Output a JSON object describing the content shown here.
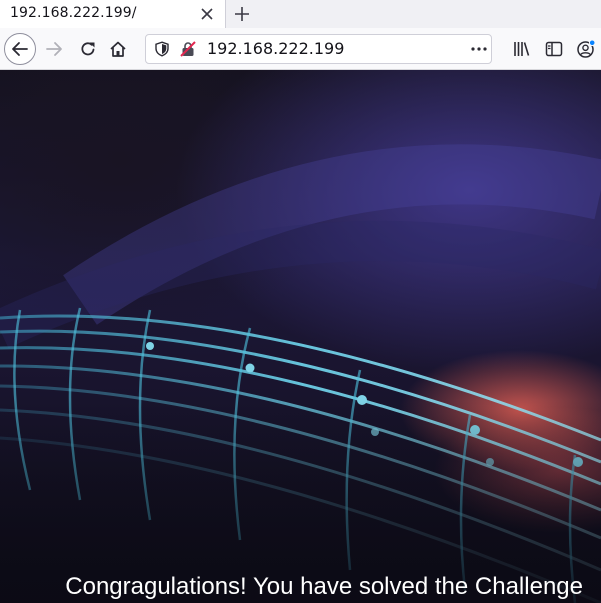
{
  "browser": {
    "tab": {
      "title": "192.168.222.199/"
    },
    "address_bar": {
      "url": "192.168.222.199"
    },
    "icons": {
      "tab_close": "close-icon",
      "new_tab": "plus-icon",
      "back": "back-arrow-icon",
      "forward": "forward-arrow-icon",
      "reload": "reload-icon",
      "home": "home-icon",
      "tracking": "shield-icon",
      "insecure": "insecure-lock-icon",
      "page_actions": "more-horizontal-icon",
      "library": "library-icon",
      "sidebar": "sidebar-icon",
      "account": "account-icon"
    },
    "colors": {
      "notification_dot": "#0a84ff"
    }
  },
  "page": {
    "message": "Congragulations! You have solved the Challenge"
  }
}
